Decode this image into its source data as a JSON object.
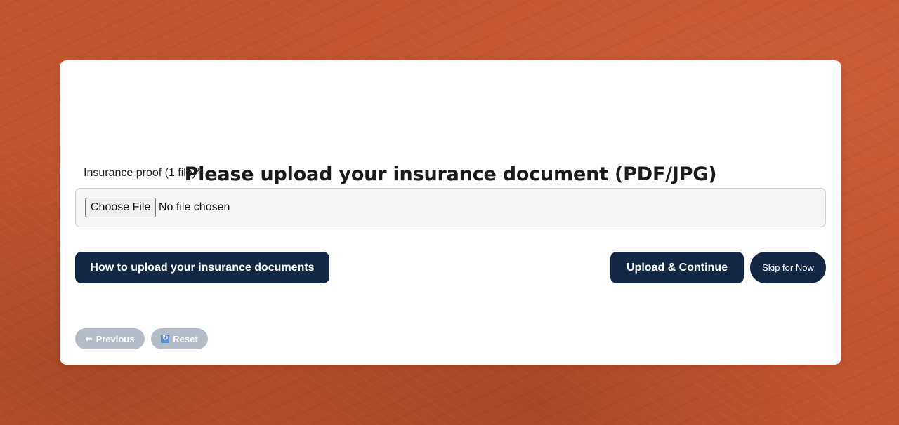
{
  "page": {
    "title": "Please upload your insurance document (PDF/JPG)"
  },
  "upload_field": {
    "label": "Insurance proof (1 file)*",
    "choose_button": "Choose File",
    "status": "No file chosen"
  },
  "actions": {
    "how_to_label": "How to upload your insurance documents",
    "upload_continue_label": "Upload & Continue",
    "skip_label": "Skip for Now"
  },
  "nav": {
    "previous_icon": "⬅",
    "previous_label": "Previous",
    "reset_icon": "🔄",
    "reset_label": "Reset"
  },
  "colors": {
    "background": "#c4532f",
    "primary_button": "#132644",
    "secondary_button": "#b4bcc8"
  }
}
